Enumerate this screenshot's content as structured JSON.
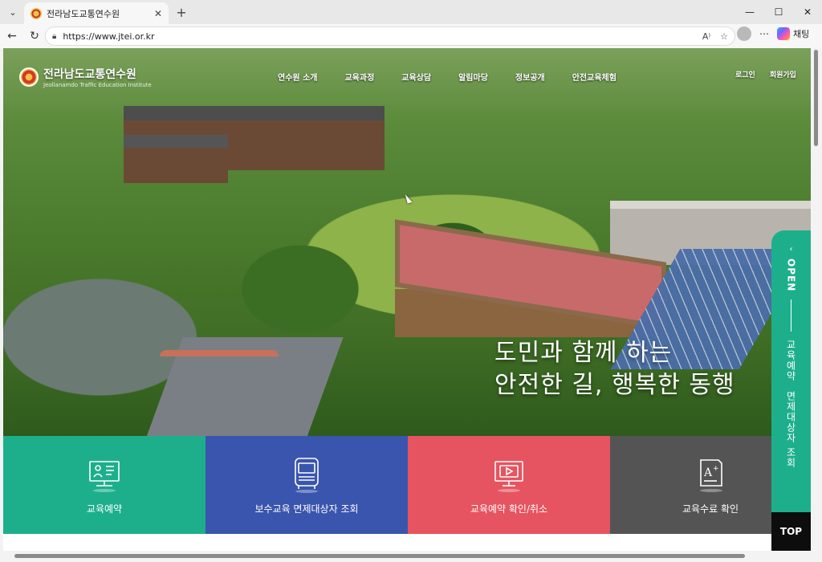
{
  "browser": {
    "tab_title": "전라남도교통연수원",
    "url": "https://www.jtei.or.kr",
    "chat_label": "채팅"
  },
  "site": {
    "logo_main": "전라남도교통연수원",
    "logo_sub": "Jeollanamdo Traffic Education Institute",
    "gnb": [
      "연수원 소개",
      "교육과정",
      "교육상담",
      "알림마당",
      "정보공개",
      "안전교육체험"
    ],
    "util": [
      "로그인",
      "회원가입"
    ],
    "slogan_line1": "도민과 함께 하는",
    "slogan_line2": "안전한 길, 행복한 동행"
  },
  "quick_menu": [
    {
      "label": "교육예약",
      "icon": "computer-reservation-icon",
      "color": "#1daf8c"
    },
    {
      "label": "보수교육 면제대상자 조회",
      "icon": "bus-icon",
      "color": "#3a55ad"
    },
    {
      "label": "교육예약 확인/취소",
      "icon": "video-monitor-icon",
      "color": "#e55460"
    },
    {
      "label": "교육수료 확인",
      "icon": "certificate-icon",
      "color": "#555455"
    }
  ],
  "side_panel": {
    "open_label": "OPEN",
    "links": [
      "교육예약",
      "면제대상자 조회"
    ],
    "top_label": "TOP"
  }
}
